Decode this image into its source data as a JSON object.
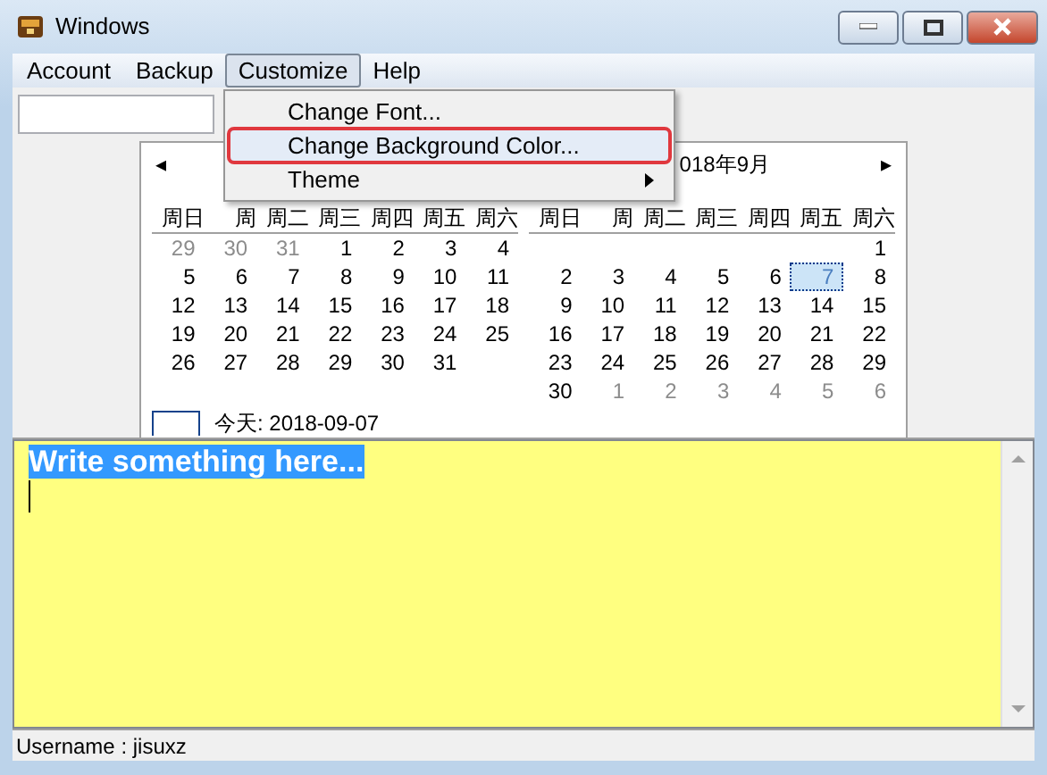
{
  "window": {
    "title": "Windows"
  },
  "menu_bar": [
    {
      "label": "Account",
      "selected": false
    },
    {
      "label": "Backup",
      "selected": false
    },
    {
      "label": "Customize",
      "selected": true
    },
    {
      "label": "Help",
      "selected": false
    }
  ],
  "dropdown": [
    {
      "label": "Change Font...",
      "highlighted": false,
      "submenu": false
    },
    {
      "label": "Change Background Color...",
      "highlighted": true,
      "submenu": false,
      "annotated": true
    },
    {
      "label": "Theme",
      "highlighted": false,
      "submenu": true
    }
  ],
  "calendar": {
    "title": "018年9月",
    "months": [
      {
        "weekdays": [
          "周日",
          "周",
          "周二",
          "周三",
          "周四",
          "周五",
          "周六"
        ],
        "weeks": [
          {
            "days": [
              {
                "t": "29",
                "dim": true
              },
              {
                "t": "30",
                "dim": true
              },
              {
                "t": "31",
                "dim": true
              },
              {
                "t": "1",
                "dim": false
              },
              {
                "t": "2",
                "dim": false
              },
              {
                "t": "3",
                "dim": false
              },
              {
                "t": "4",
                "dim": false
              }
            ]
          },
          {
            "days": [
              {
                "t": "5",
                "dim": false
              },
              {
                "t": "6",
                "dim": false
              },
              {
                "t": "7",
                "dim": false
              },
              {
                "t": "8",
                "dim": false
              },
              {
                "t": "9",
                "dim": false
              },
              {
                "t": "10",
                "dim": false
              },
              {
                "t": "11",
                "dim": false
              }
            ]
          },
          {
            "days": [
              {
                "t": "12",
                "dim": false
              },
              {
                "t": "13",
                "dim": false
              },
              {
                "t": "14",
                "dim": false
              },
              {
                "t": "15",
                "dim": false
              },
              {
                "t": "16",
                "dim": false
              },
              {
                "t": "17",
                "dim": false
              },
              {
                "t": "18",
                "dim": false
              }
            ]
          },
          {
            "days": [
              {
                "t": "19",
                "dim": false
              },
              {
                "t": "20",
                "dim": false
              },
              {
                "t": "21",
                "dim": false
              },
              {
                "t": "22",
                "dim": false
              },
              {
                "t": "23",
                "dim": false
              },
              {
                "t": "24",
                "dim": false
              },
              {
                "t": "25",
                "dim": false
              }
            ]
          },
          {
            "kind": "ends_early",
            "days": [
              {
                "t": "26",
                "dim": false
              },
              {
                "t": "27",
                "dim": false
              },
              {
                "t": "28",
                "dim": false
              },
              {
                "t": "29",
                "dim": false
              },
              {
                "t": "30",
                "dim": false
              },
              {
                "t": "31",
                "dim": false
              }
            ]
          }
        ]
      },
      {
        "weekdays": [
          "周日",
          "周",
          "周二",
          "周三",
          "周四",
          "周五",
          "周六"
        ],
        "weeks": [
          {
            "kind": "starts_late",
            "days": [
              {
                "t": "1",
                "dim": false
              }
            ]
          },
          {
            "days": [
              {
                "t": "2",
                "dim": false
              },
              {
                "t": "3",
                "dim": false
              },
              {
                "t": "4",
                "dim": false
              },
              {
                "t": "5",
                "dim": false
              },
              {
                "t": "6",
                "dim": false
              },
              {
                "t": "7",
                "dim": false,
                "selected": true
              },
              {
                "t": "8",
                "dim": false
              }
            ]
          },
          {
            "days": [
              {
                "t": "9",
                "dim": false
              },
              {
                "t": "10",
                "dim": false
              },
              {
                "t": "11",
                "dim": false
              },
              {
                "t": "12",
                "dim": false
              },
              {
                "t": "13",
                "dim": false
              },
              {
                "t": "14",
                "dim": false
              },
              {
                "t": "15",
                "dim": false
              }
            ]
          },
          {
            "days": [
              {
                "t": "16",
                "dim": false
              },
              {
                "t": "17",
                "dim": false
              },
              {
                "t": "18",
                "dim": false
              },
              {
                "t": "19",
                "dim": false
              },
              {
                "t": "20",
                "dim": false
              },
              {
                "t": "21",
                "dim": false
              },
              {
                "t": "22",
                "dim": false
              }
            ]
          },
          {
            "days": [
              {
                "t": "23",
                "dim": false
              },
              {
                "t": "24",
                "dim": false
              },
              {
                "t": "25",
                "dim": false
              },
              {
                "t": "26",
                "dim": false
              },
              {
                "t": "27",
                "dim": false
              },
              {
                "t": "28",
                "dim": false
              },
              {
                "t": "29",
                "dim": false
              }
            ]
          },
          {
            "days": [
              {
                "t": "30",
                "dim": false
              },
              {
                "t": "1",
                "dim": true
              },
              {
                "t": "2",
                "dim": true
              },
              {
                "t": "3",
                "dim": true
              },
              {
                "t": "4",
                "dim": true
              },
              {
                "t": "5",
                "dim": true
              },
              {
                "t": "6",
                "dim": true
              }
            ]
          }
        ]
      }
    ],
    "prev": "◂",
    "next": "▸",
    "today": "今天: 2018-09-07"
  },
  "memo": {
    "text": "Write something here...",
    "text_selected": true
  },
  "status_bar": "Username : jisuxz"
}
